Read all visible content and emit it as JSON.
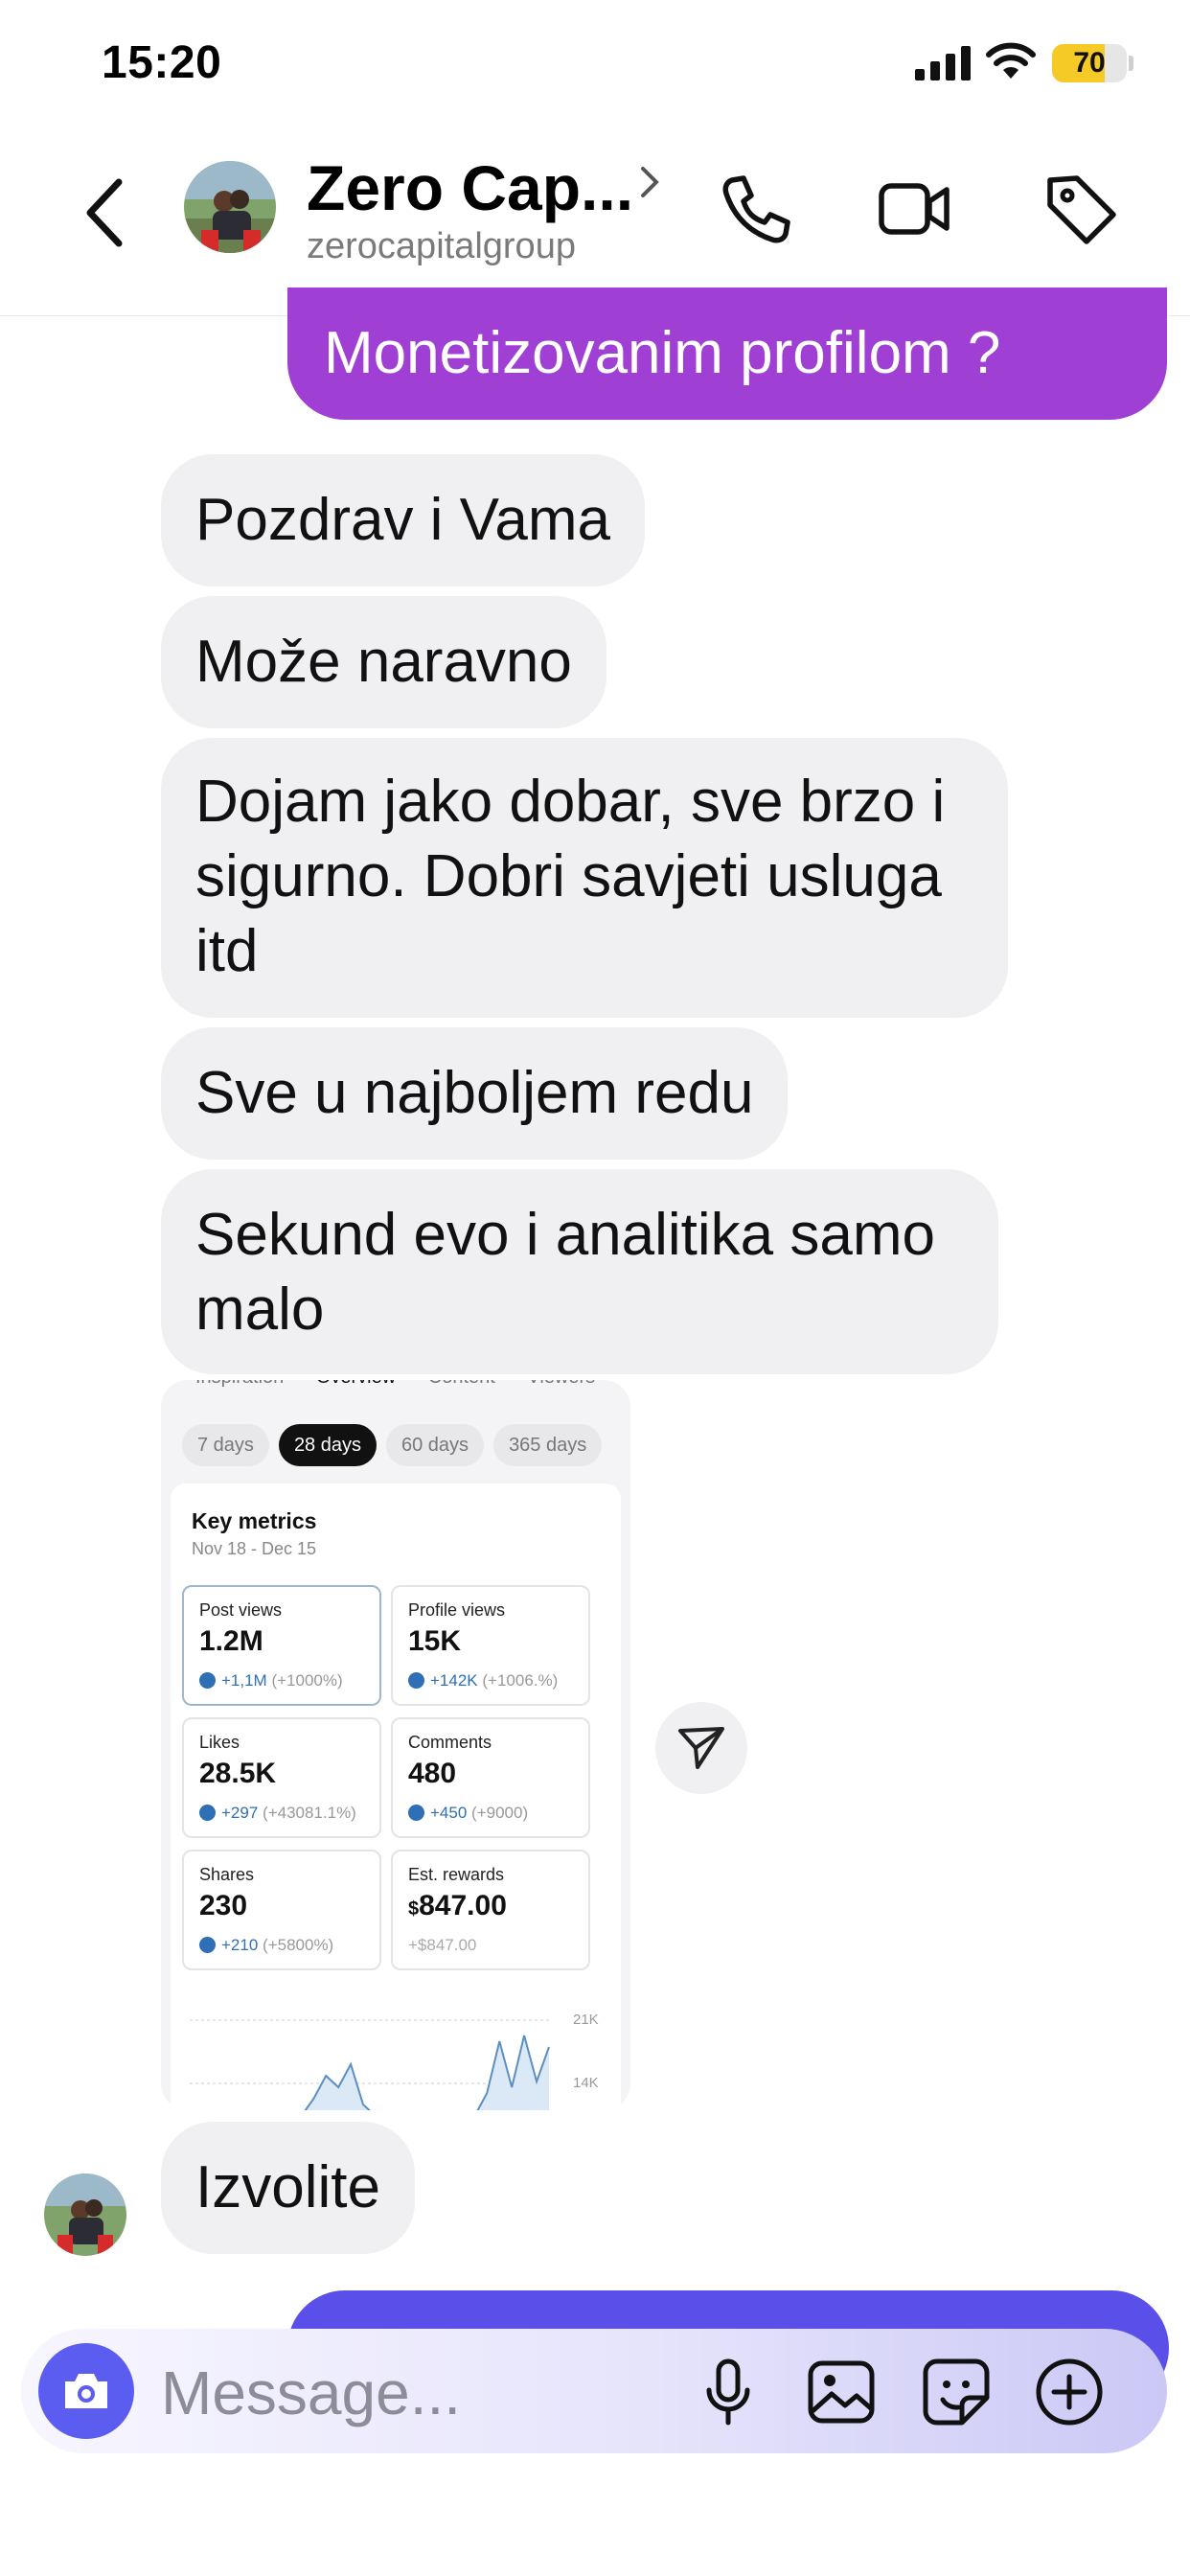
{
  "status_bar": {
    "time": "15:20",
    "battery_percent": "70",
    "battery_level": 0.7,
    "icons": [
      "cellular-signal-icon",
      "wifi-icon",
      "battery-icon"
    ]
  },
  "header": {
    "contact_name": "Zero Cap...",
    "username": "zerocapitalgroup",
    "icons": [
      "back-chevron-icon",
      "chevron-right-icon",
      "phone-icon",
      "video-camera-icon",
      "tag-icon"
    ]
  },
  "messages": {
    "outgoing_top": "Monetizovanim profilom ?",
    "incoming": [
      "Pozdrav i Vama",
      "Može naravno",
      "Dojam jako dobar, sve brzo i sigurno. Dobri savjeti usluga itd",
      "Sve u najboljem redu",
      "Sekund evo i analitika samo malo"
    ],
    "last_incoming": "Izvolite"
  },
  "attachment": {
    "tabs": [
      "Inspiration",
      "Overview",
      "Content",
      "Viewers"
    ],
    "active_tab": "Overview",
    "ranges": [
      "7 days",
      "28 days",
      "60 days",
      "365 days"
    ],
    "active_range": "28 days",
    "section_title": "Key metrics",
    "date_range": "Nov 18 - Dec 15",
    "metrics": [
      {
        "label": "Post views",
        "value": "1.2M",
        "delta": "+1,1M",
        "delta_pct": "(+1000%)"
      },
      {
        "label": "Profile views",
        "value": "15K",
        "delta": "+142K",
        "delta_pct": "(+1006.%)"
      },
      {
        "label": "Likes",
        "value": "28.5K",
        "delta": "+297",
        "delta_pct": "(+43081.1%)"
      },
      {
        "label": "Comments",
        "value": "480",
        "delta": "+450",
        "delta_pct": "(+9000)"
      },
      {
        "label": "Shares",
        "value": "230",
        "delta": "+210",
        "delta_pct": "(+5800%)"
      },
      {
        "label": "Est. rewards",
        "value_prefix": "$",
        "value": "847.00",
        "delta": "+$847.00"
      }
    ],
    "chart_axis": [
      "21K",
      "14K"
    ],
    "chart_series": [
      0,
      0,
      0,
      0,
      0,
      0,
      0,
      0,
      0,
      0,
      0.3,
      0.7,
      0.5,
      0.9,
      0.2,
      0,
      0,
      0,
      0,
      0,
      0,
      0,
      0,
      0,
      0.4,
      1.3,
      0.5,
      1.4,
      0.6,
      1.2
    ]
  },
  "input": {
    "placeholder": "Message...",
    "icons": [
      "camera-icon",
      "microphone-icon",
      "gallery-icon",
      "sticker-icon",
      "add-circle-icon"
    ]
  }
}
